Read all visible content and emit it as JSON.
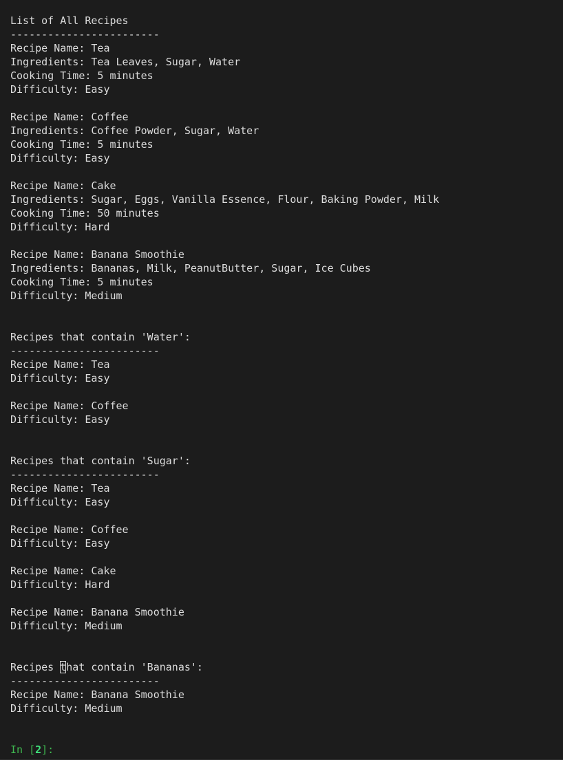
{
  "output": {
    "all": {
      "header": "List of All Recipes",
      "rule": "------------------------",
      "recipes": [
        {
          "name_line": "Recipe Name: Tea",
          "ingredients_line": "Ingredients: Tea Leaves, Sugar, Water",
          "time_line": "Cooking Time: 5 minutes",
          "difficulty_line": "Difficulty: Easy"
        },
        {
          "name_line": "Recipe Name: Coffee",
          "ingredients_line": "Ingredients: Coffee Powder, Sugar, Water",
          "time_line": "Cooking Time: 5 minutes",
          "difficulty_line": "Difficulty: Easy"
        },
        {
          "name_line": "Recipe Name: Cake",
          "ingredients_line": "Ingredients: Sugar, Eggs, Vanilla Essence, Flour, Baking Powder, Milk",
          "time_line": "Cooking Time: 50 minutes",
          "difficulty_line": "Difficulty: Hard"
        },
        {
          "name_line": "Recipe Name: Banana Smoothie",
          "ingredients_line": "Ingredients: Bananas, Milk, PeanutButter, Sugar, Ice Cubes",
          "time_line": "Cooking Time: 5 minutes",
          "difficulty_line": "Difficulty: Medium"
        }
      ]
    },
    "water": {
      "header": "Recipes that contain 'Water':",
      "rule": "------------------------",
      "recipes": [
        {
          "name_line": "Recipe Name: Tea",
          "difficulty_line": "Difficulty: Easy"
        },
        {
          "name_line": "Recipe Name: Coffee",
          "difficulty_line": "Difficulty: Easy"
        }
      ]
    },
    "sugar": {
      "header": "Recipes that contain 'Sugar':",
      "rule": "------------------------",
      "recipes": [
        {
          "name_line": "Recipe Name: Tea",
          "difficulty_line": "Difficulty: Easy"
        },
        {
          "name_line": "Recipe Name: Coffee",
          "difficulty_line": "Difficulty: Easy"
        },
        {
          "name_line": "Recipe Name: Cake",
          "difficulty_line": "Difficulty: Hard"
        },
        {
          "name_line": "Recipe Name: Banana Smoothie",
          "difficulty_line": "Difficulty: Medium"
        }
      ]
    },
    "bananas": {
      "header_prefix": "Recipes ",
      "header_cursor_char": "t",
      "header_suffix": "hat contain 'Bananas':",
      "rule": "------------------------",
      "recipes": [
        {
          "name_line": "Recipe Name: Banana Smoothie",
          "difficulty_line": "Difficulty: Medium"
        }
      ]
    }
  },
  "prompt": {
    "prefix": "In [",
    "number": "2",
    "suffix": "]:"
  },
  "colors": {
    "background": "#1c1c1c",
    "text": "#dcdcdc",
    "prompt": "#3fb950"
  }
}
